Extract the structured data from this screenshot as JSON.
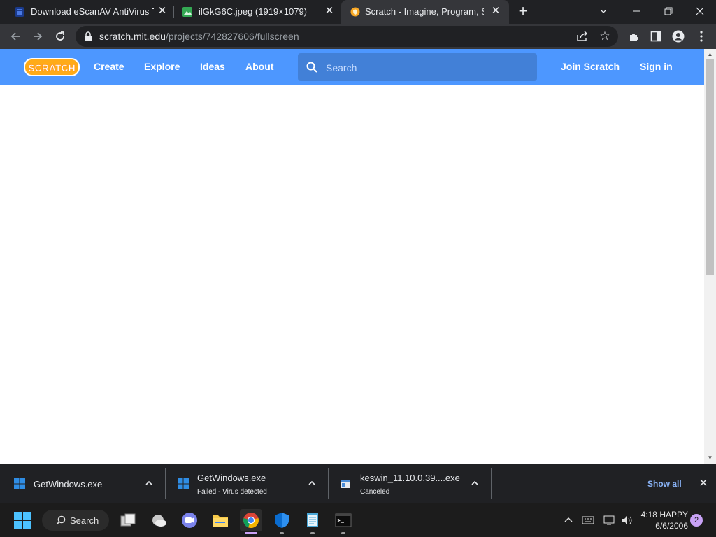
{
  "browser": {
    "tabs": [
      {
        "title": "Download eScanAV AntiVirus Too",
        "favicon": "escan-icon",
        "active": false
      },
      {
        "title": "ilGkG6C.jpeg (1919×1079)",
        "favicon": "image-file-icon",
        "active": false
      },
      {
        "title": "Scratch - Imagine, Program, Shar",
        "favicon": "scratch-cat-icon",
        "active": true
      }
    ],
    "address": {
      "host": "scratch.mit.edu",
      "path": "/projects/742827606/fullscreen"
    }
  },
  "scratch": {
    "logo_text": "SCRATCH",
    "nav": [
      "Create",
      "Explore",
      "Ideas",
      "About"
    ],
    "search_placeholder": "Search",
    "join": "Join Scratch",
    "signin": "Sign in"
  },
  "downloads": {
    "items": [
      {
        "name": "GetWindows.exe",
        "status": ""
      },
      {
        "name": "GetWindows.exe",
        "status": "Failed - Virus detected"
      },
      {
        "name": "keswin_11.10.0.39....exe",
        "status": "Canceled"
      }
    ],
    "show_all": "Show all"
  },
  "taskbar": {
    "search_label": "Search",
    "time": "4:18 HAPPY",
    "date": "6/6/2006",
    "notifications": "2"
  },
  "colors": {
    "scratch_blue": "#4d97ff",
    "scratch_search": "#4280d7",
    "chrome_dark": "#202124",
    "chrome_toolbar": "#35363a",
    "show_all": "#8ab4f8"
  }
}
